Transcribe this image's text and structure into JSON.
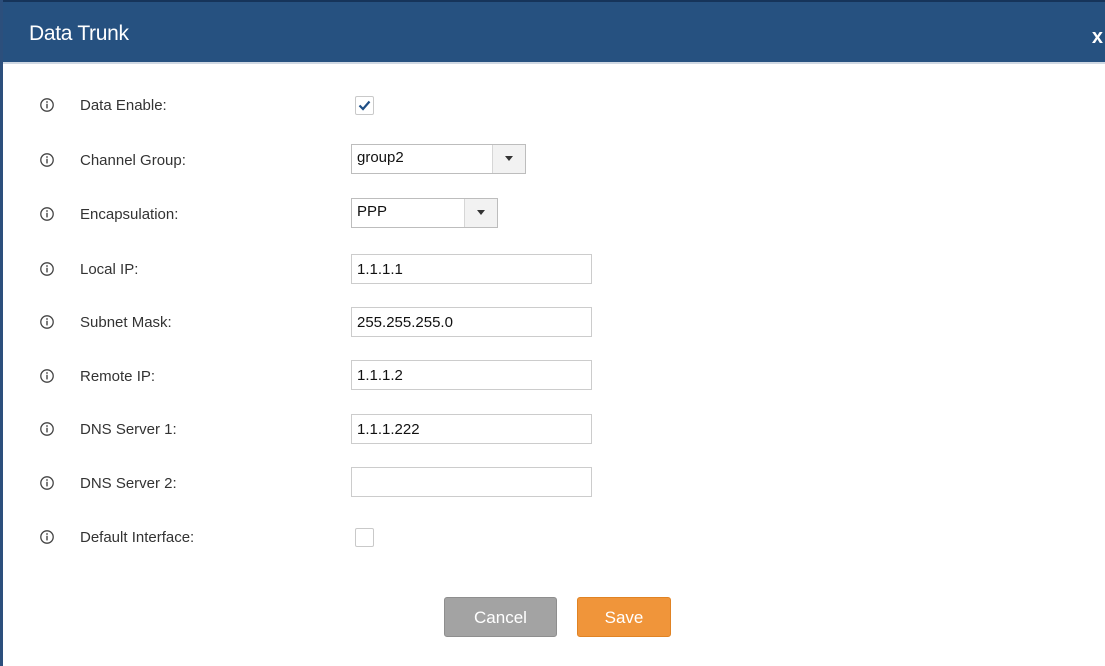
{
  "dialog": {
    "title": "Data Trunk",
    "close_label": "x"
  },
  "fields": {
    "data_enable": {
      "label": "Data Enable:",
      "checked": true
    },
    "channel_group": {
      "label": "Channel Group:",
      "value": "group2"
    },
    "encapsulation": {
      "label": "Encapsulation:",
      "value": "PPP"
    },
    "local_ip": {
      "label": "Local IP:",
      "value": "1.1.1.1"
    },
    "subnet_mask": {
      "label": "Subnet Mask:",
      "value": "255.255.255.0"
    },
    "remote_ip": {
      "label": "Remote IP:",
      "value": "1.1.1.2"
    },
    "dns_server_1": {
      "label": "DNS Server 1:",
      "value": "1.1.1.222"
    },
    "dns_server_2": {
      "label": "DNS Server 2:",
      "value": ""
    },
    "default_interface": {
      "label": "Default Interface:",
      "checked": false
    }
  },
  "buttons": {
    "cancel": "Cancel",
    "save": "Save"
  },
  "colors": {
    "titlebar": "#265180",
    "save_button": "#f0953a",
    "cancel_button": "#a3a3a3",
    "info_icon": "#444444"
  },
  "icons": {
    "info": "info-circle-icon",
    "check": "checkmark-icon",
    "dropdown": "triangle-down-icon"
  }
}
